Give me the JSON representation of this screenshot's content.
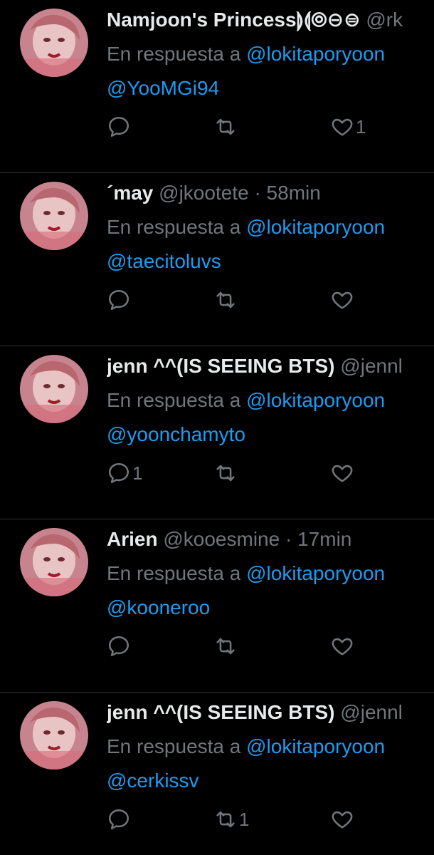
{
  "colors": {
    "background": "#000000",
    "text": "#e7e9ea",
    "muted": "#71767b",
    "link": "#1d9bf0",
    "divider": "#2f3336"
  },
  "tweets": [
    {
      "name": "Namjoon's Princess",
      "name_suffix": "⟭⟬⦾⊖⊜",
      "handle": "@rk",
      "dot": "",
      "time": "",
      "reply_prefix": "En respuesta a",
      "reply_to": "@lokitaporyoon",
      "mention": "@YooMGi94",
      "reply_count": "",
      "retweet_count": "",
      "like_count": "1"
    },
    {
      "name": "´may",
      "name_suffix": "",
      "handle": "@jkootete",
      "dot": "·",
      "time": "58min",
      "reply_prefix": "En respuesta a",
      "reply_to": "@lokitaporyoon",
      "mention": "@taecitoluvs",
      "reply_count": "",
      "retweet_count": "",
      "like_count": ""
    },
    {
      "name": "jenn ^^(IS SEEING BTS)",
      "name_suffix": "",
      "handle": "@jennl",
      "dot": "",
      "time": "",
      "reply_prefix": "En respuesta a",
      "reply_to": "@lokitaporyoon",
      "mention": "@yoonchamyto",
      "reply_count": "1",
      "retweet_count": "",
      "like_count": ""
    },
    {
      "name": "Arien",
      "name_suffix": "",
      "handle": "@kooesmine",
      "dot": "·",
      "time": "17min",
      "reply_prefix": "En respuesta a",
      "reply_to": "@lokitaporyoon",
      "mention": "@kooneroo",
      "reply_count": "",
      "retweet_count": "",
      "like_count": ""
    },
    {
      "name": "jenn ^^(IS SEEING BTS)",
      "name_suffix": "",
      "handle": "@jennl",
      "dot": "",
      "time": "",
      "reply_prefix": "En respuesta a",
      "reply_to": "@lokitaporyoon",
      "mention": "@cerkissv",
      "reply_count": "",
      "retweet_count": "1",
      "like_count": ""
    }
  ]
}
